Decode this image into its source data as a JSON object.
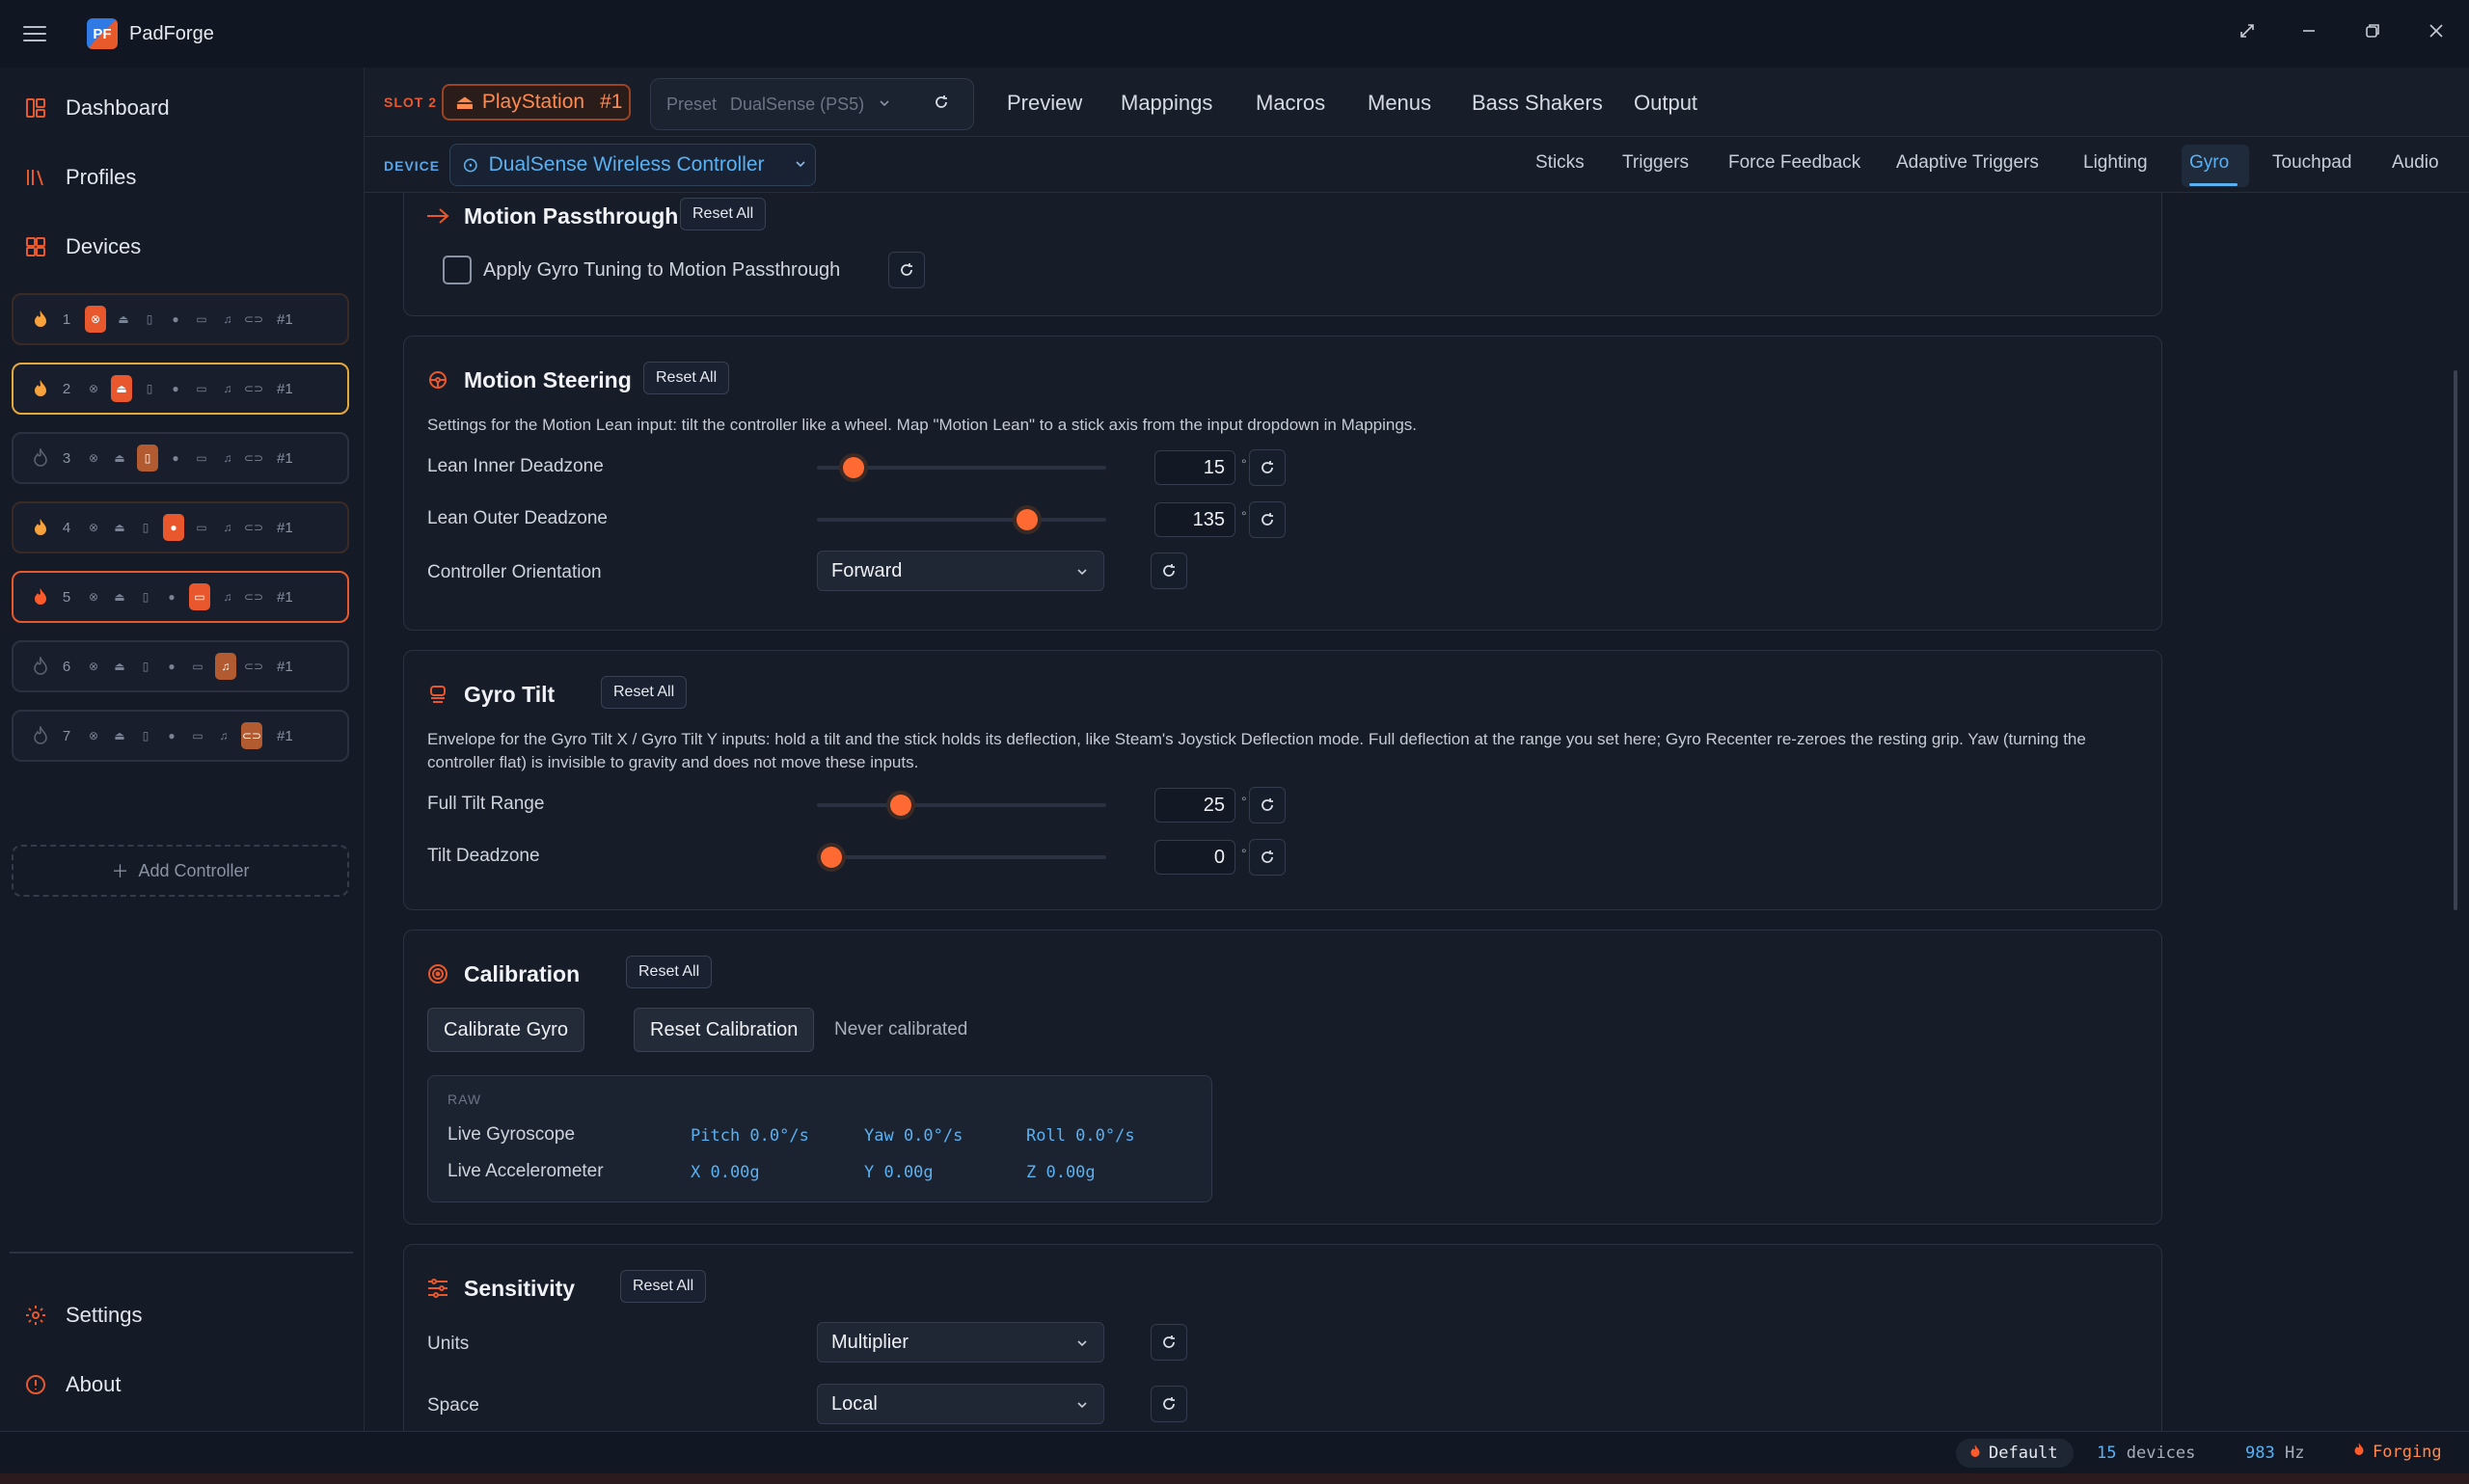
{
  "app": {
    "title": "PadForge",
    "logo": "PF"
  },
  "sidebar": {
    "nav": [
      {
        "label": "Dashboard",
        "icon": "dashboard-icon"
      },
      {
        "label": "Profiles",
        "icon": "profiles-icon"
      },
      {
        "label": "Devices",
        "icon": "devices-icon"
      }
    ],
    "slots": [
      {
        "number": "1",
        "tag": "#1"
      },
      {
        "number": "2",
        "tag": "#1"
      },
      {
        "number": "3",
        "tag": "#1"
      },
      {
        "number": "4",
        "tag": "#1"
      },
      {
        "number": "5",
        "tag": "#1"
      },
      {
        "number": "6",
        "tag": "#1"
      },
      {
        "number": "7",
        "tag": "#1"
      }
    ],
    "add_controller": "Add Controller",
    "bottom_nav": [
      {
        "label": "Settings",
        "icon": "gear-icon"
      },
      {
        "label": "About",
        "icon": "info-icon"
      }
    ]
  },
  "topbar": {
    "slot_label": "SLOT 2",
    "controller_type": "PlayStation",
    "controller_num": "#1",
    "preset_label": "Preset",
    "preset_value": "DualSense (PS5)",
    "tabs": [
      "Preview",
      "Mappings",
      "Macros",
      "Menus",
      "Bass Shakers",
      "Output"
    ]
  },
  "devicebar": {
    "label": "DEVICE",
    "device": "DualSense Wireless Controller",
    "tabs": [
      "Sticks",
      "Triggers",
      "Force Feedback",
      "Adaptive Triggers",
      "Lighting",
      "Gyro",
      "Touchpad",
      "Audio"
    ],
    "active_tab": "Gyro"
  },
  "reset_all": "Reset All",
  "deg": "°",
  "motion_passthrough": {
    "title": "Motion Passthrough",
    "checkbox_label": "Apply Gyro Tuning to Motion Passthrough",
    "checked": false
  },
  "motion_steering": {
    "title": "Motion Steering",
    "description": "Settings for the Motion Lean input: tilt the controller like a wheel. Map \"Motion Lean\" to a stick axis from the input dropdown in Mappings.",
    "inner_label": "Lean Inner Deadzone",
    "inner_value": "15",
    "inner_fraction": 0.125,
    "outer_label": "Lean Outer Deadzone",
    "outer_value": "135",
    "outer_fraction": 0.725,
    "orientation_label": "Controller Orientation",
    "orientation_value": "Forward"
  },
  "gyro_tilt": {
    "title": "Gyro Tilt",
    "description": "Envelope for the Gyro Tilt X / Gyro Tilt Y inputs: hold a tilt and the stick holds its deflection, like Steam's Joystick Deflection mode. Full deflection at the range you set here; Gyro Recenter re-zeroes the resting grip. Yaw (turning the controller flat) is invisible to gravity and does not move these inputs.",
    "range_label": "Full Tilt Range",
    "range_value": "25",
    "range_fraction": 0.29,
    "deadzone_label": "Tilt Deadzone",
    "deadzone_value": "0",
    "deadzone_fraction": 0.05
  },
  "calibration": {
    "title": "Calibration",
    "calibrate_btn": "Calibrate Gyro",
    "reset_btn": "Reset Calibration",
    "status": "Never calibrated",
    "raw_label": "RAW",
    "gyro_label": "Live Gyroscope",
    "pitch": "Pitch 0.0°/s",
    "yaw": "Yaw 0.0°/s",
    "roll": "Roll 0.0°/s",
    "accel_label": "Live Accelerometer",
    "ax": "X 0.00g",
    "ay": "Y 0.00g",
    "az": "Z 0.00g"
  },
  "sensitivity": {
    "title": "Sensitivity",
    "units_label": "Units",
    "units_value": "Multiplier",
    "space_label": "Space",
    "space_value": "Local"
  },
  "status": {
    "profile": "Default",
    "devices_count": "15",
    "devices_label": "devices",
    "rate": "983",
    "rate_unit": "Hz",
    "state": "Forging"
  },
  "colors": {
    "accent": "#e8582c",
    "blue": "#5ab1f2",
    "background": "#141a26"
  }
}
